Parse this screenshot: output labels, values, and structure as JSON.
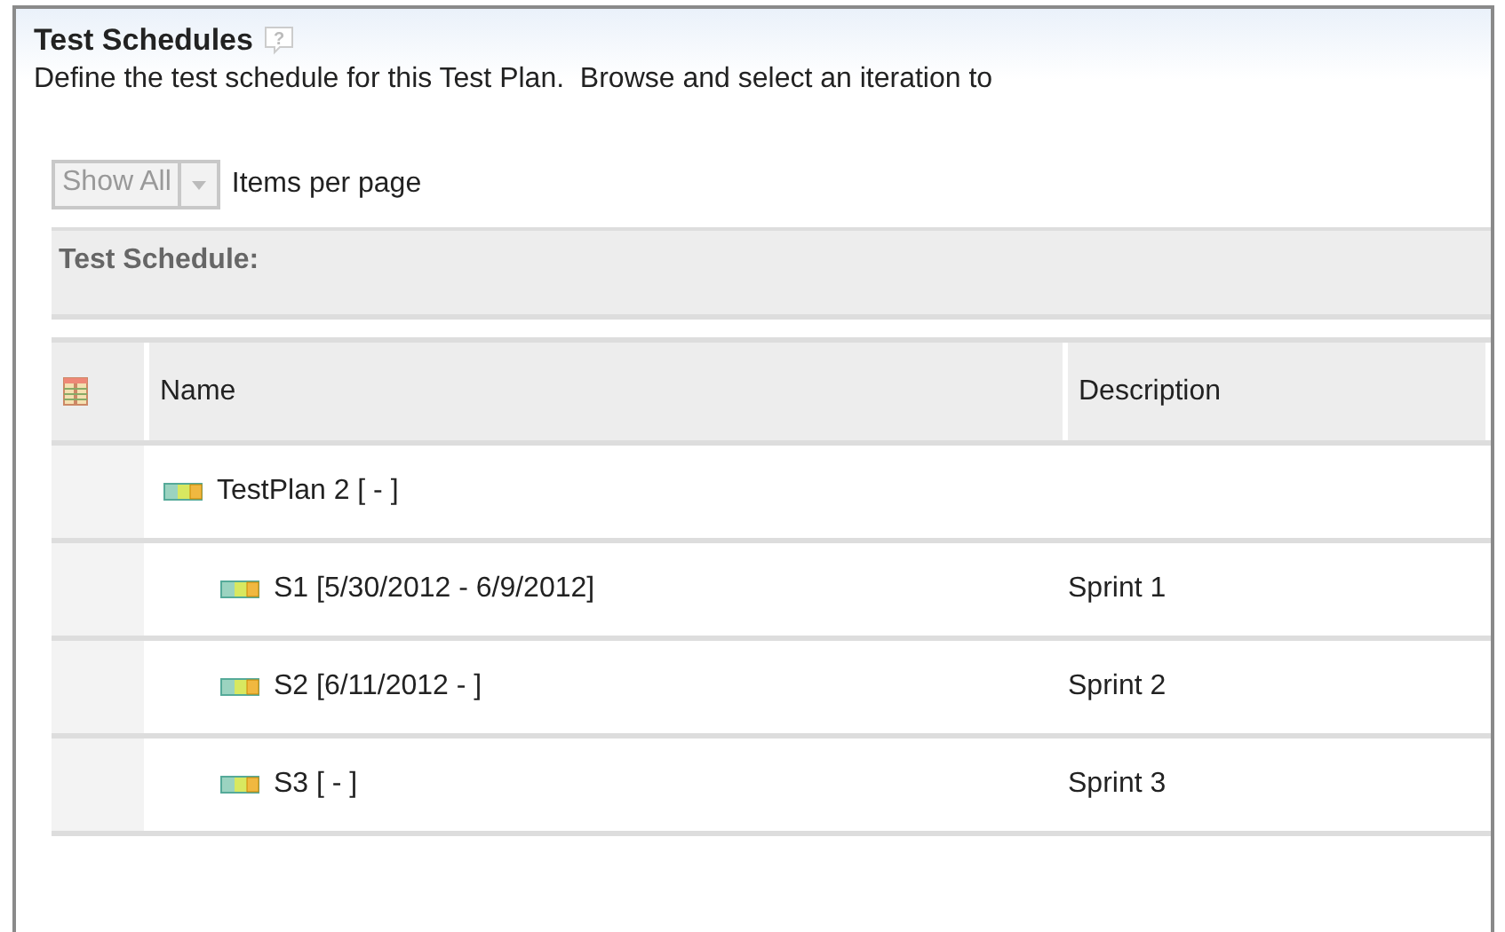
{
  "section": {
    "title": "Test Schedules",
    "help": "?",
    "description": "Define the test schedule for this Test Plan.  Browse and select an iteration to"
  },
  "pager": {
    "value": "Show All",
    "disabled": true,
    "label": "Items per page"
  },
  "group_header": "Test Schedule:",
  "table": {
    "columns": [
      "Name",
      "Description"
    ],
    "rows": [
      {
        "name": "TestPlan 2 [ - ]",
        "children": [
          {
            "name": "S1 [5/30/2012 - 6/9/2012]",
            "description": "Sprint 1"
          },
          {
            "name": "S2 [6/11/2012 - ]",
            "description": "Sprint 2"
          },
          {
            "name": "S3 [ - ]",
            "description": "Sprint 3"
          }
        ]
      }
    ]
  }
}
